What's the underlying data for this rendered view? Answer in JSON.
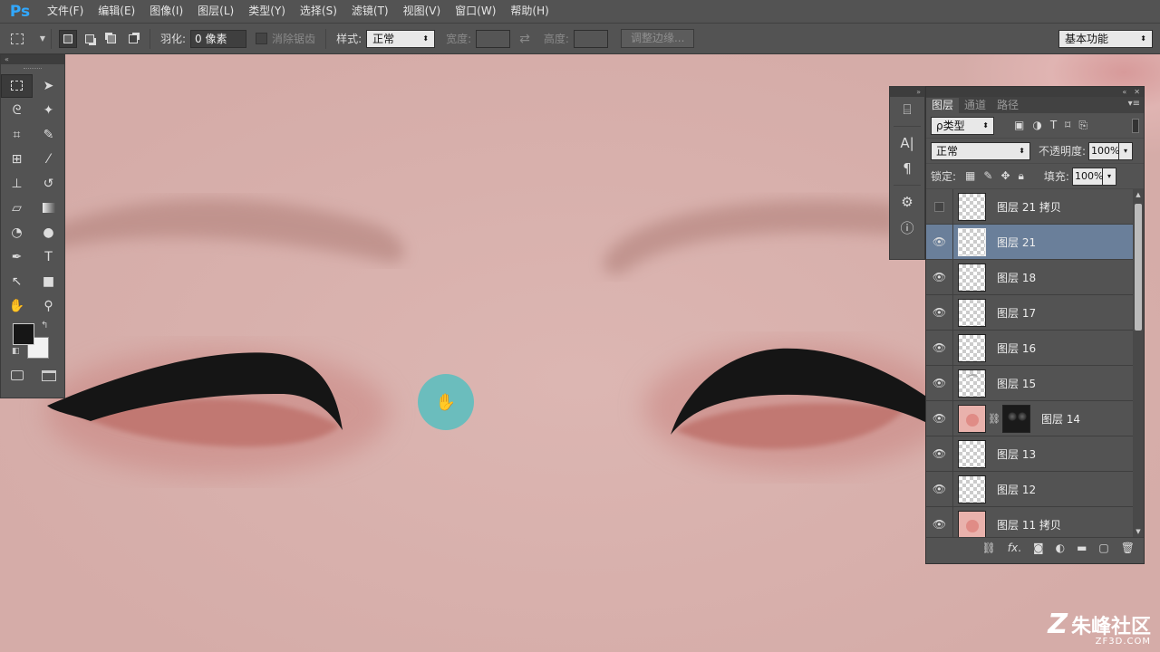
{
  "app": {
    "logo": "Ps"
  },
  "menu": [
    "文件(F)",
    "编辑(E)",
    "图像(I)",
    "图层(L)",
    "类型(Y)",
    "选择(S)",
    "滤镜(T)",
    "视图(V)",
    "窗口(W)",
    "帮助(H)"
  ],
  "options": {
    "feather_label": "羽化:",
    "feather_value": "0 像素",
    "antialias_label": "消除锯齿",
    "style_label": "样式:",
    "style_value": "正常",
    "width_label": "宽度:",
    "height_label": "高度:",
    "refine_edge": "调整边缘...",
    "workspace": "基本功能"
  },
  "layers_panel": {
    "tabs": [
      "图层",
      "通道",
      "路径"
    ],
    "filter_kind": "ρ类型",
    "blend_mode": "正常",
    "opacity_label": "不透明度:",
    "opacity_value": "100%",
    "lock_label": "锁定:",
    "fill_label": "填充:",
    "fill_value": "100%",
    "layers": [
      {
        "name": "图层 21 拷贝",
        "visible": false,
        "selected": false,
        "thumb": "transparent"
      },
      {
        "name": "图层 21",
        "visible": true,
        "selected": true,
        "thumb": "transparent"
      },
      {
        "name": "图层 18",
        "visible": true,
        "selected": false,
        "thumb": "transparent"
      },
      {
        "name": "图层 17",
        "visible": true,
        "selected": false,
        "thumb": "transparent"
      },
      {
        "name": "图层 16",
        "visible": true,
        "selected": false,
        "thumb": "transparent"
      },
      {
        "name": "图层 15",
        "visible": true,
        "selected": false,
        "thumb": "ghost"
      },
      {
        "name": "图层 14",
        "visible": true,
        "selected": false,
        "thumb": "face-with-mask"
      },
      {
        "name": "图层 13",
        "visible": true,
        "selected": false,
        "thumb": "transparent"
      },
      {
        "name": "图层 12",
        "visible": true,
        "selected": false,
        "thumb": "transparent"
      },
      {
        "name": "图层 11 拷贝",
        "visible": true,
        "selected": false,
        "thumb": "face"
      }
    ]
  },
  "colors": {
    "foreground": "#161616",
    "background": "#f2f2f2",
    "skin": "#d8b0ac",
    "cursor_marker": "#6bbdbd",
    "selected_layer": "#6a7f9a"
  },
  "watermark": {
    "brand": "朱峰社区",
    "url": "ZF3D.COM"
  }
}
